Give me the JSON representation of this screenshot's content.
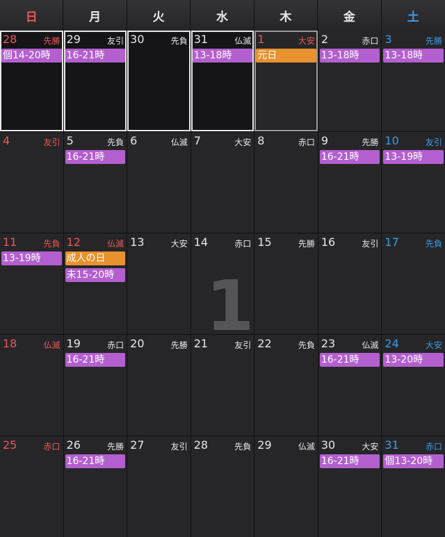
{
  "colors": {
    "sunday": "#e85858",
    "saturday": "#3c9be6",
    "default": "#e8e8e8",
    "event_purple": "#b35fcf",
    "event_orange": "#e8922f"
  },
  "weekdays": [
    {
      "label": "日",
      "color": "sunday"
    },
    {
      "label": "月",
      "color": "default"
    },
    {
      "label": "火",
      "color": "default"
    },
    {
      "label": "水",
      "color": "default"
    },
    {
      "label": "木",
      "color": "default"
    },
    {
      "label": "金",
      "color": "default"
    },
    {
      "label": "土",
      "color": "saturday"
    }
  ],
  "month_mark": "1",
  "days": [
    {
      "day": "28",
      "rokuyo": "先勝",
      "color": "sunday",
      "prev": true,
      "outline": "white",
      "events": [
        {
          "text": "個14-20時",
          "color": "event_purple"
        }
      ]
    },
    {
      "day": "29",
      "rokuyo": "友引",
      "color": "default",
      "prev": true,
      "outline": "white",
      "events": [
        {
          "text": "16-21時",
          "color": "event_purple"
        }
      ]
    },
    {
      "day": "30",
      "rokuyo": "先負",
      "color": "default",
      "prev": true,
      "outline": "white",
      "events": []
    },
    {
      "day": "31",
      "rokuyo": "仏滅",
      "color": "default",
      "prev": true,
      "outline": "white",
      "events": [
        {
          "text": "13-18時",
          "color": "event_purple"
        }
      ]
    },
    {
      "day": "1",
      "rokuyo": "大安",
      "color": "sunday",
      "outline": "grey",
      "events": [
        {
          "text": "元日",
          "color": "event_orange"
        }
      ]
    },
    {
      "day": "2",
      "rokuyo": "赤口",
      "color": "default",
      "events": [
        {
          "text": "13-18時",
          "color": "event_purple"
        }
      ]
    },
    {
      "day": "3",
      "rokuyo": "先勝",
      "color": "saturday",
      "events": [
        {
          "text": "13-18時",
          "color": "event_purple"
        }
      ]
    },
    {
      "day": "4",
      "rokuyo": "友引",
      "color": "sunday",
      "events": []
    },
    {
      "day": "5",
      "rokuyo": "先負",
      "color": "default",
      "events": [
        {
          "text": "16-21時",
          "color": "event_purple"
        }
      ]
    },
    {
      "day": "6",
      "rokuyo": "仏滅",
      "color": "default",
      "events": []
    },
    {
      "day": "7",
      "rokuyo": "大安",
      "color": "default",
      "events": []
    },
    {
      "day": "8",
      "rokuyo": "赤口",
      "color": "default",
      "events": []
    },
    {
      "day": "9",
      "rokuyo": "先勝",
      "color": "default",
      "events": [
        {
          "text": "16-21時",
          "color": "event_purple"
        }
      ]
    },
    {
      "day": "10",
      "rokuyo": "友引",
      "color": "saturday",
      "events": [
        {
          "text": "13-19時",
          "color": "event_purple"
        }
      ]
    },
    {
      "day": "11",
      "rokuyo": "先負",
      "color": "sunday",
      "events": [
        {
          "text": "13-19時",
          "color": "event_purple"
        }
      ]
    },
    {
      "day": "12",
      "rokuyo": "仏滅",
      "color": "sunday",
      "events": [
        {
          "text": "成人の日",
          "color": "event_orange"
        },
        {
          "text": "未15-20時",
          "color": "event_purple"
        }
      ]
    },
    {
      "day": "13",
      "rokuyo": "大安",
      "color": "default",
      "events": []
    },
    {
      "day": "14",
      "rokuyo": "赤口",
      "color": "default",
      "events": []
    },
    {
      "day": "15",
      "rokuyo": "先勝",
      "color": "default",
      "events": []
    },
    {
      "day": "16",
      "rokuyo": "友引",
      "color": "default",
      "events": []
    },
    {
      "day": "17",
      "rokuyo": "先負",
      "color": "saturday",
      "events": []
    },
    {
      "day": "18",
      "rokuyo": "仏滅",
      "color": "sunday",
      "events": []
    },
    {
      "day": "19",
      "rokuyo": "赤口",
      "color": "default",
      "events": [
        {
          "text": "16-21時",
          "color": "event_purple"
        }
      ]
    },
    {
      "day": "20",
      "rokuyo": "先勝",
      "color": "default",
      "events": []
    },
    {
      "day": "21",
      "rokuyo": "友引",
      "color": "default",
      "events": []
    },
    {
      "day": "22",
      "rokuyo": "先負",
      "color": "default",
      "events": []
    },
    {
      "day": "23",
      "rokuyo": "仏滅",
      "color": "default",
      "events": [
        {
          "text": "16-21時",
          "color": "event_purple"
        }
      ]
    },
    {
      "day": "24",
      "rokuyo": "大安",
      "color": "saturday",
      "events": [
        {
          "text": "13-20時",
          "color": "event_purple"
        }
      ]
    },
    {
      "day": "25",
      "rokuyo": "赤口",
      "color": "sunday",
      "events": []
    },
    {
      "day": "26",
      "rokuyo": "先勝",
      "color": "default",
      "events": [
        {
          "text": "16-21時",
          "color": "event_purple"
        }
      ]
    },
    {
      "day": "27",
      "rokuyo": "友引",
      "color": "default",
      "events": []
    },
    {
      "day": "28",
      "rokuyo": "先負",
      "color": "default",
      "events": []
    },
    {
      "day": "29",
      "rokuyo": "仏滅",
      "color": "default",
      "events": []
    },
    {
      "day": "30",
      "rokuyo": "大安",
      "color": "default",
      "events": [
        {
          "text": "16-21時",
          "color": "event_purple"
        }
      ]
    },
    {
      "day": "31",
      "rokuyo": "赤口",
      "color": "saturday",
      "events": [
        {
          "text": "個13-20時",
          "color": "event_purple"
        }
      ]
    }
  ]
}
